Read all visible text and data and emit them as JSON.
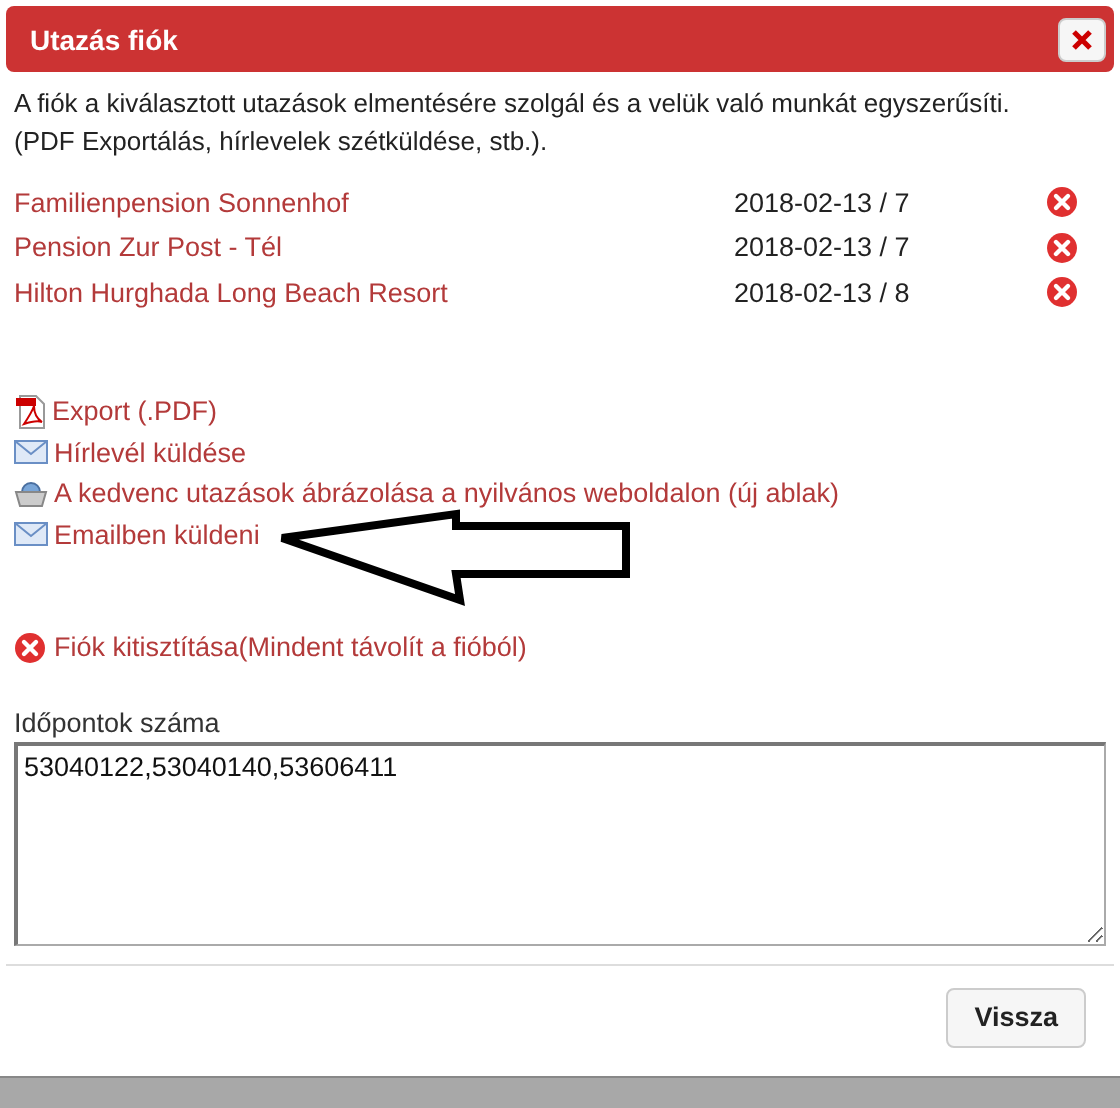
{
  "dialog": {
    "title": "Utazás fiók",
    "description": "A fiók a kiválasztott utazások elmentésére szolgál és a velük való munkát egyszerűsíti. (PDF Exportálás, hírlevelek szétküldése, stb.).",
    "trips": [
      {
        "name": "Familienpension Sonnenhof",
        "date": "2018-02-13 / 7"
      },
      {
        "name": "Pension Zur Post - Tél",
        "date": "2018-02-13 / 7"
      },
      {
        "name": "Hilton Hurghada Long Beach Resort",
        "date": "2018-02-13 / 8"
      }
    ],
    "actions": [
      {
        "kind": "pdf",
        "label": "Export (.PDF)"
      },
      {
        "kind": "mail",
        "label": "Hírlevél küldése"
      },
      {
        "kind": "basket",
        "label": "A kedvenc utazások ábrázolása a nyilvános weboldalon (új ablak)"
      },
      {
        "kind": "mail",
        "label": "Emailben küldeni"
      }
    ],
    "clear": "Fiók kitisztítása(Mindent távolít a fióból)",
    "ids_label": "Időpontok száma",
    "ids_value": "53040122,53040140,53606411",
    "back_button": "Vissza"
  }
}
